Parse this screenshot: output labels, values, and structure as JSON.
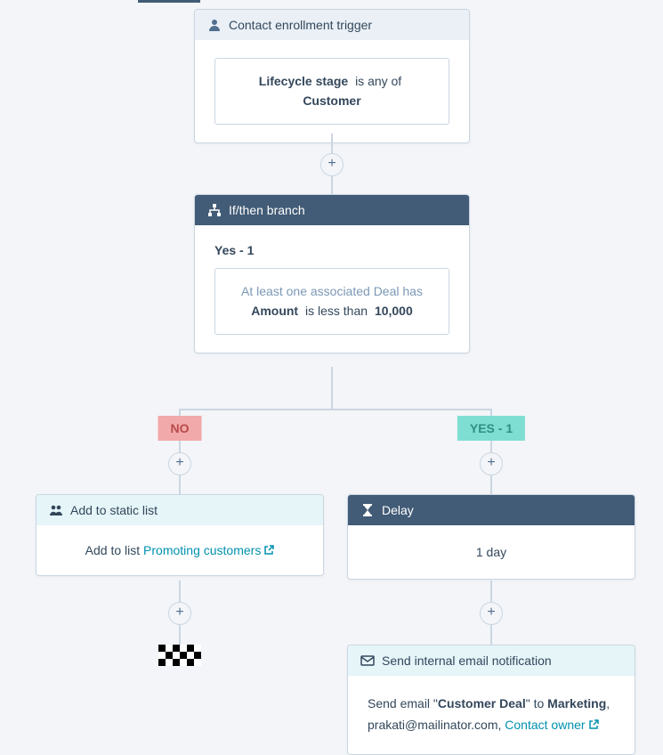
{
  "trigger": {
    "header": "Contact enrollment trigger",
    "filter_field": "Lifecycle stage",
    "filter_op": "is any of",
    "filter_value": "Customer"
  },
  "branch": {
    "header": "If/then branch",
    "group_label": "Yes - 1",
    "cond_pre": "At least one associated Deal has",
    "cond_field": "Amount",
    "cond_op": "is less than",
    "cond_value": "10,000",
    "pill_no": "NO",
    "pill_yes": "YES - 1"
  },
  "static_list": {
    "header": "Add to static list",
    "body_prefix": "Add to list ",
    "link_text": "Promoting customers"
  },
  "delay": {
    "header": "Delay",
    "body": "1 day"
  },
  "email": {
    "header": "Send internal email notification",
    "body_prefix": "Send email \"",
    "deal_name": "Customer Deal",
    "body_mid": "\" to ",
    "recipient1": "Marketing",
    "sep": ", ",
    "recipient2": "prakati@mailinator.com",
    "link_text": "Contact owner"
  }
}
